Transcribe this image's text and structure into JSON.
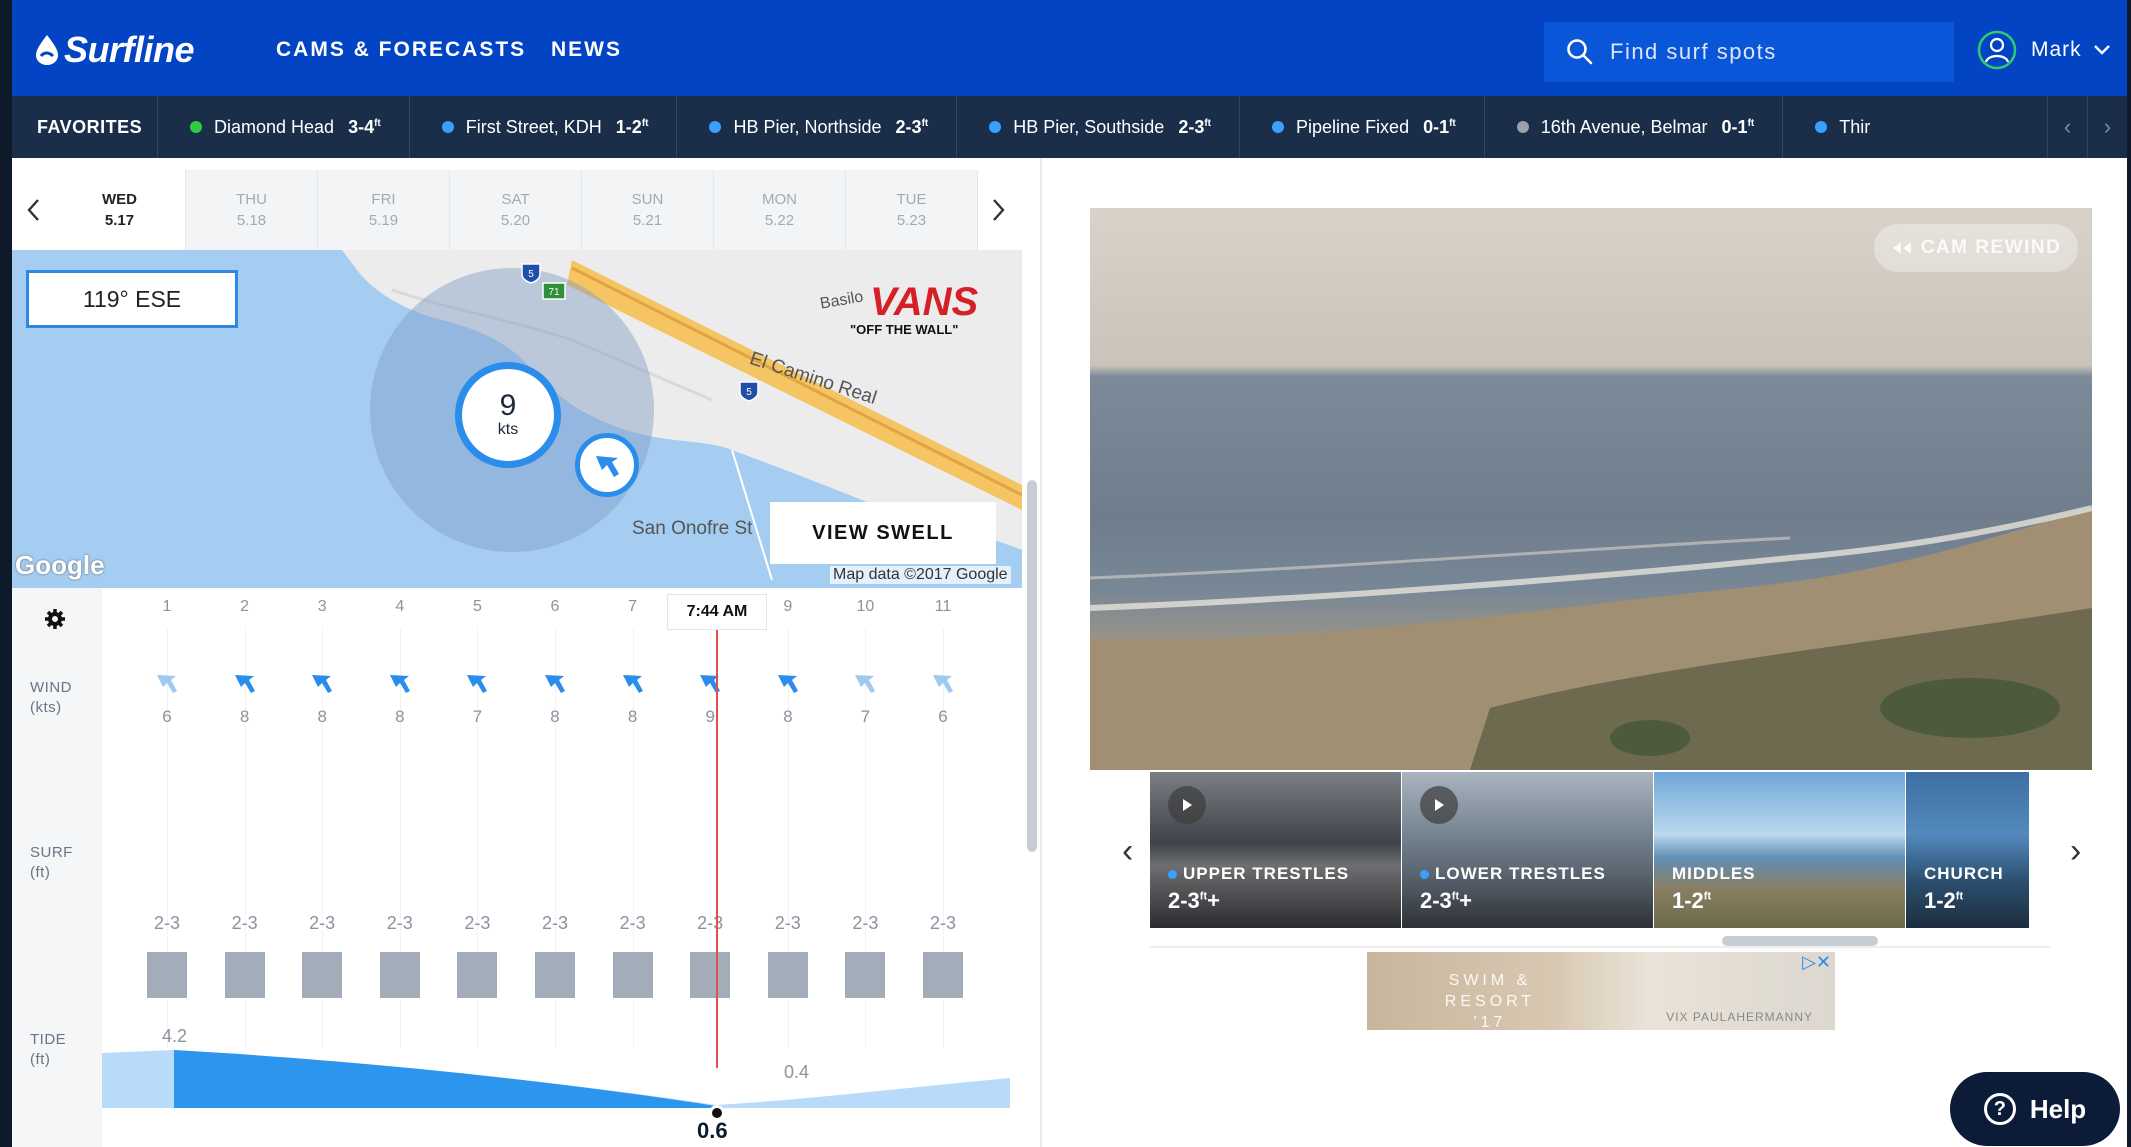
{
  "header": {
    "logo": "Surfline",
    "nav": [
      "CAMS & FORECASTS",
      "NEWS"
    ],
    "search_placeholder": "Find surf spots",
    "user_name": "Mark"
  },
  "favorites": {
    "title": "FAVORITES",
    "items": [
      {
        "name": "Diamond Head",
        "height": "3-4",
        "unit": "ft",
        "color": "#2ecc40"
      },
      {
        "name": "First Street, KDH",
        "height": "1-2",
        "unit": "ft",
        "color": "#3aa0ff"
      },
      {
        "name": "HB Pier, Northside",
        "height": "2-3",
        "unit": "ft",
        "color": "#3aa0ff"
      },
      {
        "name": "HB Pier, Southside",
        "height": "2-3",
        "unit": "ft",
        "color": "#3aa0ff"
      },
      {
        "name": "Pipeline Fixed",
        "height": "0-1",
        "unit": "ft",
        "color": "#3aa0ff"
      },
      {
        "name": "16th Avenue, Belmar",
        "height": "0-1",
        "unit": "ft",
        "color": "#9aa3ad"
      },
      {
        "name": "Thir",
        "height": "",
        "unit": "",
        "color": "#3aa0ff"
      }
    ]
  },
  "days": [
    {
      "dow": "WED",
      "date": "5.17"
    },
    {
      "dow": "THU",
      "date": "5.18"
    },
    {
      "dow": "FRI",
      "date": "5.19"
    },
    {
      "dow": "SAT",
      "date": "5.20"
    },
    {
      "dow": "SUN",
      "date": "5.21"
    },
    {
      "dow": "MON",
      "date": "5.22"
    },
    {
      "dow": "TUE",
      "date": "5.23"
    }
  ],
  "map": {
    "swell_direction": "119° ESE",
    "wind_speed": "9",
    "wind_unit": "kts",
    "view_swell": "VIEW SWELL",
    "place_label": "San Onofre St",
    "road_label": "El Camino Real",
    "attribution": "Map data ©2017 Google",
    "google": "Google",
    "highway_5": "5",
    "highway_71": "71",
    "ad_brand": "VANS",
    "ad_tagline": "\"OFF THE WALL\"",
    "ad_prefix": "Basilo"
  },
  "forecast": {
    "labels": {
      "wind": "WIND",
      "wind_unit": "(kts)",
      "surf": "SURF",
      "surf_unit": "(ft)",
      "tide": "TIDE",
      "tide_unit": "(ft)"
    },
    "hours": [
      "1",
      "2",
      "3",
      "4",
      "5",
      "6",
      "7",
      "",
      "9",
      "10",
      "11"
    ],
    "now_time": "7:44 AM",
    "wind": [
      "6",
      "8",
      "8",
      "8",
      "7",
      "8",
      "8",
      "9",
      "8",
      "7",
      "6"
    ],
    "surf": [
      "2-3",
      "2-3",
      "2-3",
      "2-3",
      "2-3",
      "2-3",
      "2-3",
      "2-3",
      "2-3",
      "2-3",
      "2-3"
    ],
    "tide_high": "4.2",
    "tide_low": "0.4",
    "tide_now": "0.6"
  },
  "camera": {
    "rewind_label": "CAM REWIND",
    "thumbnails": [
      {
        "name": "UPPER TRESTLES",
        "height": "2-3",
        "suffix": "+",
        "playing": true
      },
      {
        "name": "LOWER TRESTLES",
        "height": "2-3",
        "suffix": "+",
        "playing": true
      },
      {
        "name": "MIDDLES",
        "height": "1-2",
        "suffix": "",
        "playing": false
      },
      {
        "name": "CHURCH",
        "height": "1-2",
        "suffix": "",
        "playing": false
      }
    ]
  },
  "ad": {
    "text": "SWIM & RESORT '17",
    "brand": "VIX PAULAHERMANNY"
  },
  "help": "Help"
}
